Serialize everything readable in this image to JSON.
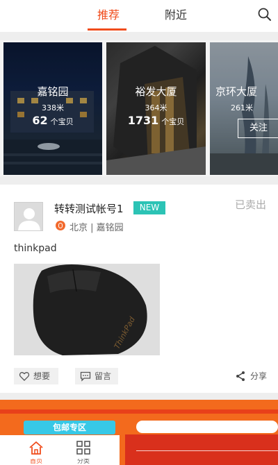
{
  "topbar": {
    "tabs": [
      {
        "label": "推荐",
        "active": true
      },
      {
        "label": "附近",
        "active": false
      }
    ],
    "search_icon": "search-icon"
  },
  "location_cards": [
    {
      "name": "嘉铭园",
      "distance": "338米",
      "count": "62",
      "count_unit": "个宝贝"
    },
    {
      "name": "裕发大厦",
      "distance": "364米",
      "count": "1731",
      "count_unit": "个宝贝"
    },
    {
      "name": "京环大厦",
      "distance": "261米",
      "follow_label": "关注"
    }
  ],
  "post": {
    "username": "转转测试帐号1",
    "badge": "NEW",
    "status": "已卖出",
    "location": "北京 | 嘉铭园",
    "title": "thinkpad",
    "image_text": "ThinkPad",
    "actions": {
      "like": "想要",
      "comment": "留言",
      "share": "分享"
    }
  },
  "promo": {
    "ribbon": "包邮专区"
  },
  "bottom_nav": [
    {
      "label": "首页",
      "icon": "home-icon",
      "active": true
    },
    {
      "label": "分类",
      "icon": "grid-icon",
      "active": false
    }
  ],
  "colors": {
    "accent": "#f04c1c",
    "badge": "#2cc3b5",
    "promo": "#f36a1d",
    "ribbon": "#37c8e6"
  }
}
